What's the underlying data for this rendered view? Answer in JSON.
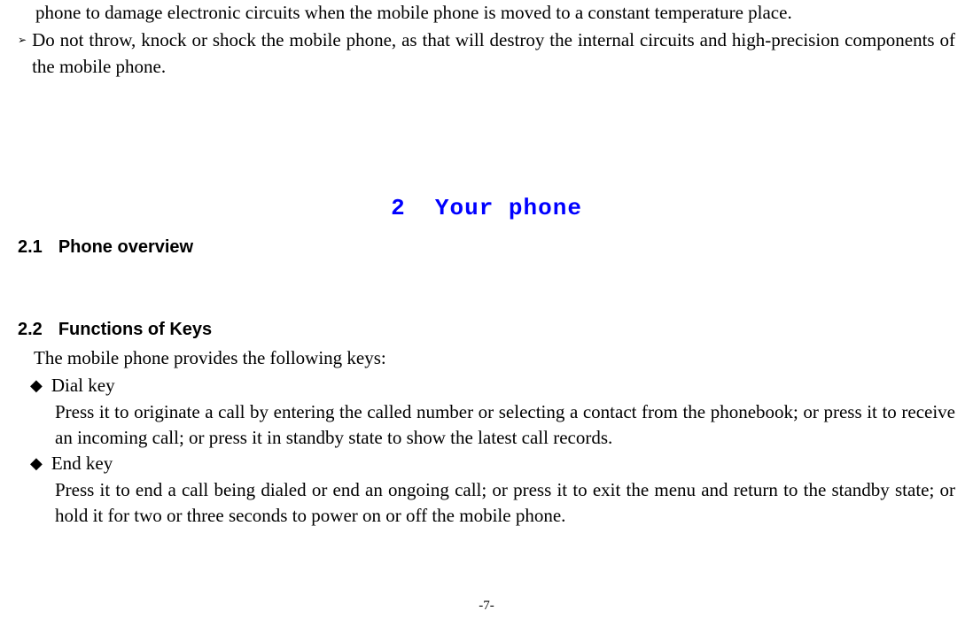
{
  "continuation": "phone to damage electronic circuits when the mobile phone is moved to a constant temperature place.",
  "precaution": {
    "marker": "➢",
    "text": "Do not throw, knock or shock the mobile phone, as that will destroy the internal circuits and high-precision components of the mobile phone."
  },
  "chapter": {
    "number": "2",
    "title": "Your phone"
  },
  "sections": {
    "s21": {
      "number": "2.1",
      "title": "Phone overview"
    },
    "s22": {
      "number": "2.2",
      "title": "Functions of Keys",
      "intro": "The mobile phone provides the following keys:",
      "keys": [
        {
          "marker": "◆",
          "name": "Dial key",
          "desc": "Press it to originate a call by entering the called number or selecting a contact from the phonebook; or press it to receive an incoming call; or press it in standby state to show the latest call records."
        },
        {
          "marker": "◆",
          "name": "End key",
          "desc": "Press it to end a call being dialed or end an ongoing call; or press it to exit the menu and return to the standby state; or hold it for two or three seconds to power on or off the mobile phone."
        }
      ]
    }
  },
  "pageNumber": "-7-"
}
